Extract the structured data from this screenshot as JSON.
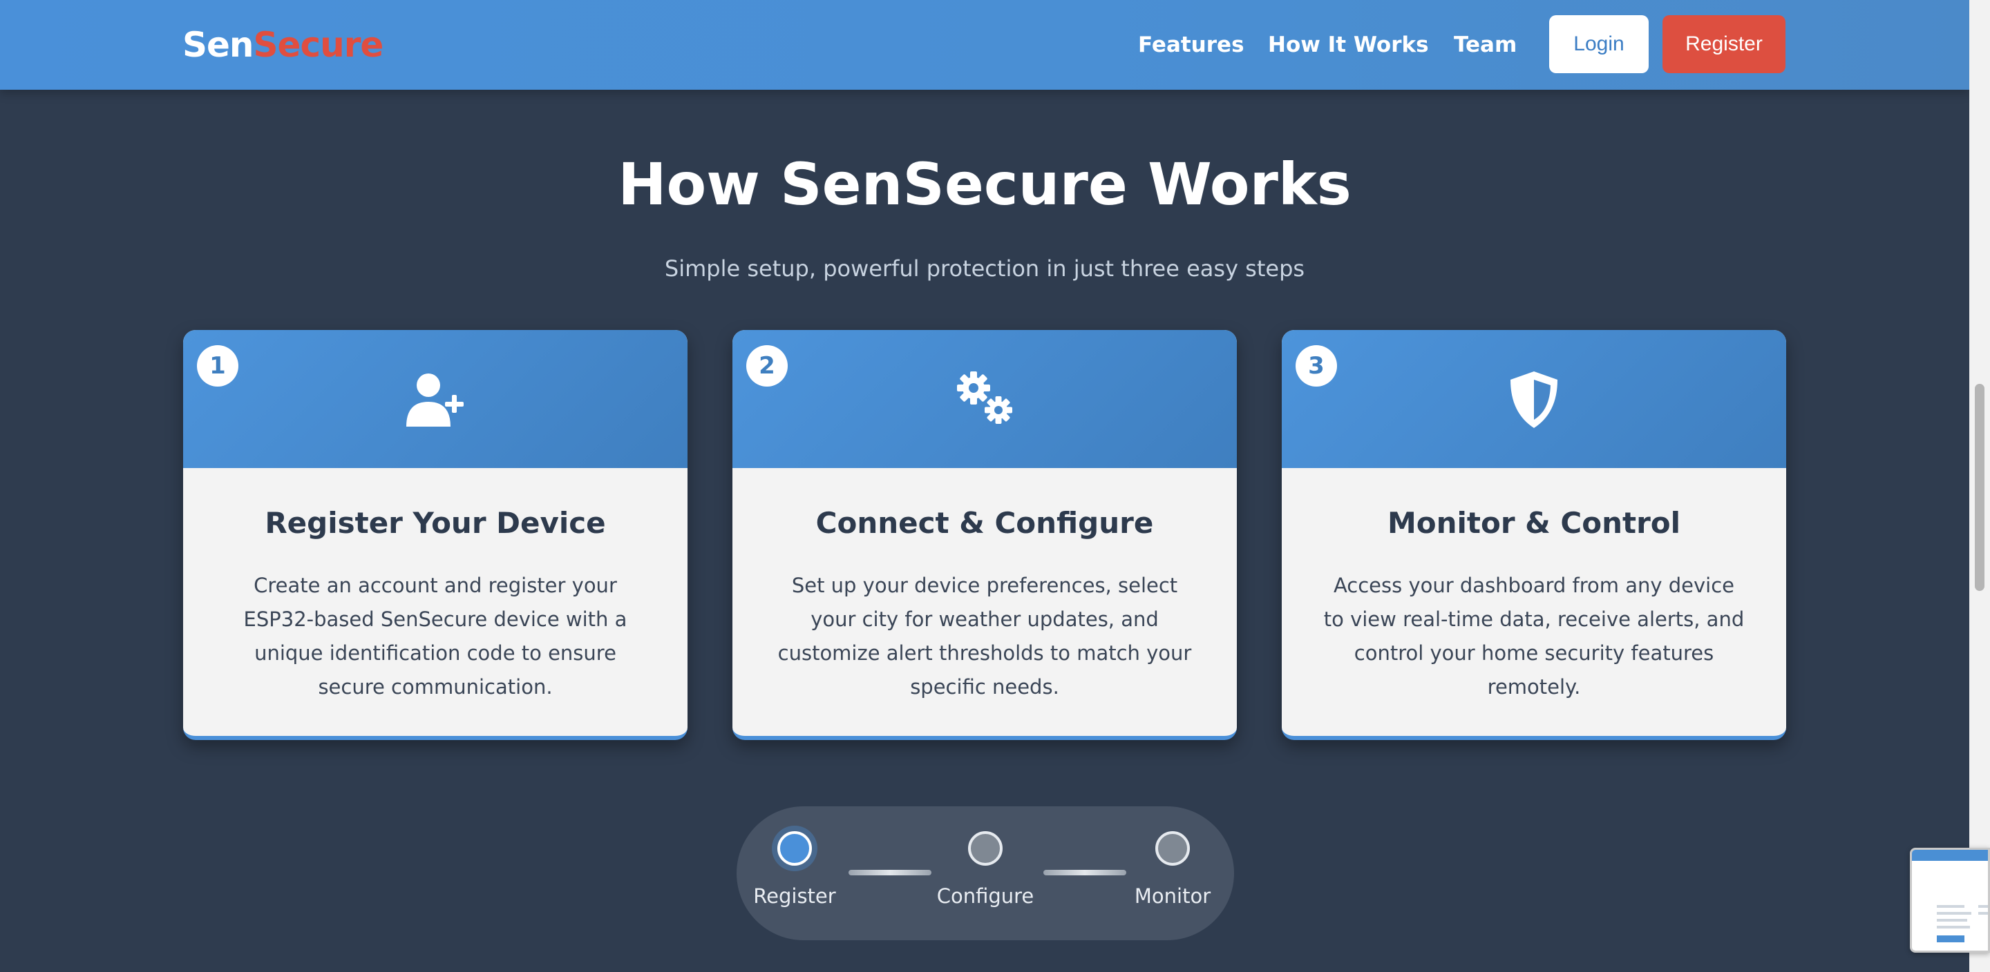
{
  "brand": {
    "part1": "Sen",
    "part2": "Secure",
    "color1": "#ffffff",
    "color2": "#e04e3f"
  },
  "nav": {
    "links": [
      "Features",
      "How It Works",
      "Team"
    ],
    "login_label": "Login",
    "register_label": "Register"
  },
  "hero": {
    "title": "How SenSecure Works",
    "subtitle": "Simple setup, powerful protection in just three easy steps"
  },
  "steps": [
    {
      "number": "1",
      "icon": "user-plus-icon",
      "title": "Register Your Device",
      "text": "Create an account and register your ESP32-based SenSecure device with a unique identification code to ensure secure communication."
    },
    {
      "number": "2",
      "icon": "gears-icon",
      "title": "Connect & Configure",
      "text": "Set up your device preferences, select your city for weather updates, and customize alert thresholds to match your specific needs."
    },
    {
      "number": "3",
      "icon": "shield-icon",
      "title": "Monitor & Control",
      "text": "Access your dashboard from any device to view real-time data, receive alerts, and control your home security features remotely."
    }
  ],
  "progress": {
    "labels": [
      "Register",
      "Configure",
      "Monitor"
    ],
    "active_index": 0
  },
  "colors": {
    "accent": "#4a90d9",
    "register_button": "#dd4f40",
    "background": "#2f3c4f"
  }
}
